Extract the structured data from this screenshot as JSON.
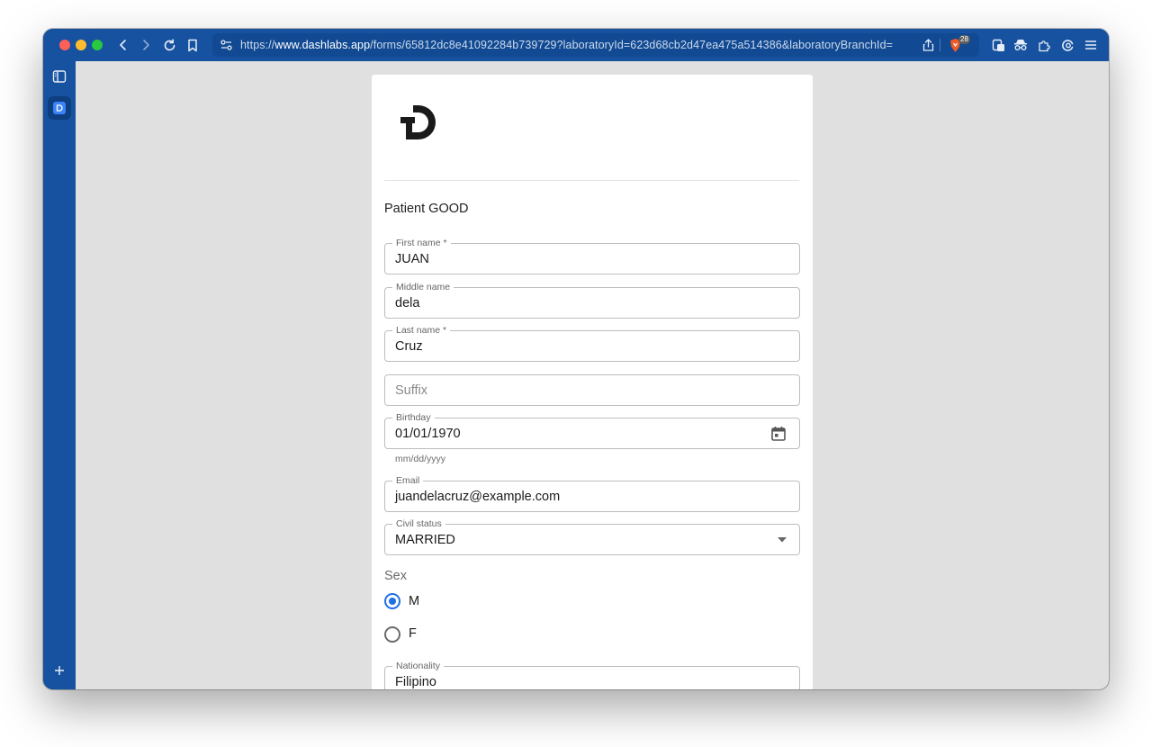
{
  "browser": {
    "url_prefix": "https://",
    "url_domain": "www.dashlabs.app",
    "url_path": "/forms/65812dc8e41092284b739729?laboratoryId=623d68cb2d47ea475a514386&laboratoryBranchId=",
    "shields_count": "28"
  },
  "form": {
    "title": "Patient GOOD",
    "first_name": {
      "label": "First name",
      "required_mark": "*",
      "value": "JUAN"
    },
    "middle_name": {
      "label": "Middle name",
      "value": "dela"
    },
    "last_name": {
      "label": "Last name",
      "required_mark": "*",
      "value": "Cruz"
    },
    "suffix": {
      "placeholder": "Suffix"
    },
    "birthday": {
      "label": "Birthday",
      "value": "01/01/1970",
      "helper": "mm/dd/yyyy"
    },
    "email": {
      "label": "Email",
      "value": "juandelacruz@example.com"
    },
    "civil_status": {
      "label": "Civil status",
      "value": "MARRIED"
    },
    "sex": {
      "label": "Sex",
      "options": [
        {
          "label": "M",
          "selected": true
        },
        {
          "label": "F",
          "selected": false
        }
      ]
    },
    "nationality": {
      "label": "Nationality",
      "value": "Filipino"
    }
  },
  "colors": {
    "browser_chrome": "#1652a0",
    "accent": "#1f6fe5",
    "page_bg": "#e0e0e0"
  },
  "icons": [
    "back-icon",
    "forward-icon",
    "reload-icon",
    "bookmark-icon",
    "site-settings-icon",
    "share-icon",
    "brave-shields-icon",
    "wallet-icon",
    "incognito-icon",
    "extensions-icon",
    "leo-icon",
    "menu-icon",
    "sidebar-toggle-icon",
    "calendar-icon",
    "dropdown-arrow-icon",
    "add-icon"
  ]
}
